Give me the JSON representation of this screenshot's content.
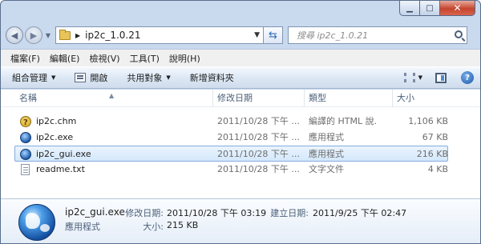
{
  "window": {
    "minimize_glyph": "▁",
    "maximize_glyph": "□",
    "close_glyph": "✕"
  },
  "address": {
    "path": "ip2c_1.0.21",
    "search_placeholder": "搜尋 ip2c_1.0.21"
  },
  "menu": [
    "檔案(F)",
    "編輯(E)",
    "檢視(V)",
    "工具(T)",
    "說明(H)"
  ],
  "commands": {
    "organize": "組合管理",
    "open": "開啟",
    "share": "共用對象",
    "new_folder": "新增資料夾"
  },
  "columns": {
    "name": "名稱",
    "date": "修改日期",
    "type": "類型",
    "size": "大小"
  },
  "files": [
    {
      "name": "ip2c.chm",
      "date": "2011/10/28 下午 ...",
      "type": "編譯的 HTML 說...",
      "size": "1,106 KB",
      "icon": "help-file-icon"
    },
    {
      "name": "ip2c.exe",
      "date": "2011/10/28 下午 ...",
      "type": "應用程式",
      "size": "67 KB",
      "icon": "exe-icon"
    },
    {
      "name": "ip2c_gui.exe",
      "date": "2011/10/28 下午 ...",
      "type": "應用程式",
      "size": "216 KB",
      "icon": "exe-icon",
      "selected": true
    },
    {
      "name": "readme.txt",
      "date": "2011/10/28 下午 ...",
      "type": "文字文件",
      "size": "4 KB",
      "icon": "txt-icon"
    }
  ],
  "details": {
    "name": "ip2c_gui.exe",
    "type": "應用程式",
    "modified_label": "修改日期:",
    "modified_value": "2011/10/28 下午 03:19",
    "created_label": "建立日期:",
    "created_value": "2011/9/25 下午 02:47",
    "size_label": "大小:",
    "size_value": "215 KB"
  }
}
